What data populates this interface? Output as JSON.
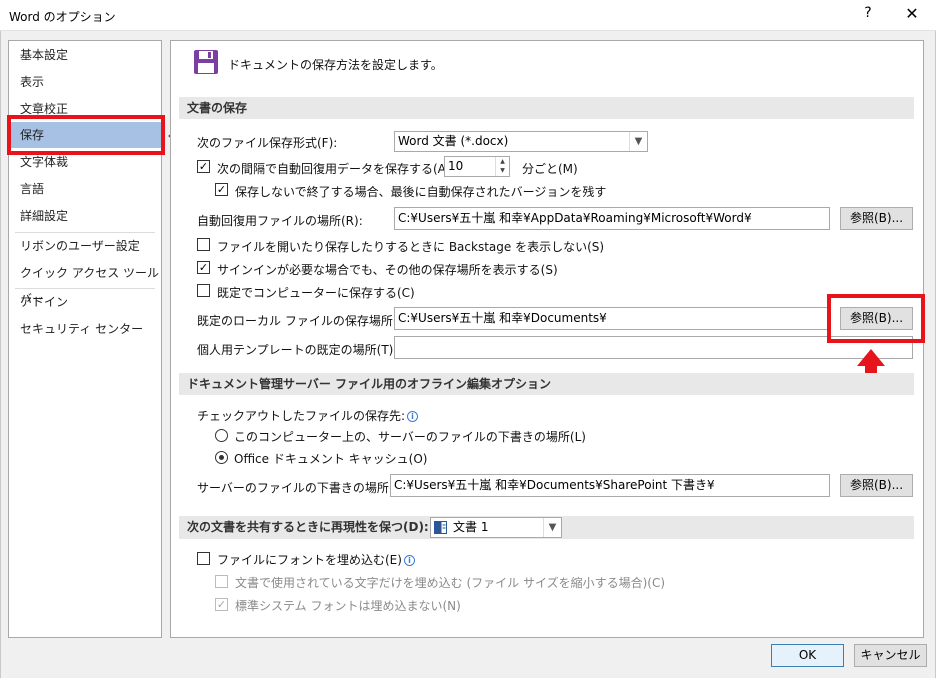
{
  "window": {
    "title": "Word のオプション",
    "help": "?",
    "close": "✕"
  },
  "sidebar": {
    "items": [
      {
        "label": "基本設定"
      },
      {
        "label": "表示"
      },
      {
        "label": "文章校正"
      },
      {
        "label": "保存"
      },
      {
        "label": "文字体裁"
      },
      {
        "label": "言語"
      },
      {
        "label": "詳細設定"
      },
      {
        "label": "リボンのユーザー設定"
      },
      {
        "label": "クイック アクセス ツール バー"
      },
      {
        "label": "アドイン"
      },
      {
        "label": "セキュリティ センター"
      }
    ]
  },
  "header": {
    "description": "ドキュメントの保存方法を設定します。",
    "icon": "floppy-disk-icon"
  },
  "doc_save": {
    "section_title": "文書の保存",
    "format_label": "次のファイル保存形式(F):",
    "format_value": "Word 文書 (*.docx)",
    "autorecover_label": "次の間隔で自動回復用データを保存する(A):",
    "autorecover_checked": "✓",
    "autorecover_minutes": "10",
    "autorecover_unit": "分ごと(M)",
    "keep_last_label": "保存しないで終了する場合、最後に自動保存されたバージョンを残す",
    "keep_last_checked": "✓",
    "autorecover_location_label": "自動回復用ファイルの場所(R):",
    "autorecover_location_value": "C:¥Users¥五十嵐 和幸¥AppData¥Roaming¥Microsoft¥Word¥",
    "browse_label": "参照(B)...",
    "backstage_label": "ファイルを開いたり保存したりするときに Backstage を表示しない(S)",
    "signin_label": "サインインが必要な場合でも、その他の保存場所を表示する(S)",
    "signin_checked": "✓",
    "save_to_computer_label": "既定でコンピューターに保存する(C)",
    "local_location_label": "既定のローカル ファイルの保存場所(I):",
    "local_location_value": "C:¥Users¥五十嵐 和幸¥Documents¥",
    "template_location_label": "個人用テンプレートの既定の場所(T):",
    "template_location_value": ""
  },
  "offline": {
    "section_title": "ドキュメント管理サーバー ファイル用のオフライン編集オプション",
    "checkout_label": "チェックアウトしたファイルの保存先:",
    "info_icon": "i",
    "radio_server_label": "このコンピューター上の、サーバーのファイルの下書きの場所(L)",
    "radio_cache_label": "Office ドキュメント キャッシュ(O)",
    "drafts_label": "サーバーのファイルの下書きの場所(V):",
    "drafts_value": "C:¥Users¥五十嵐 和幸¥Documents¥SharePoint 下書き¥"
  },
  "fidelity": {
    "section_title": "次の文書を共有するときに再現性を保つ(D):",
    "document_value": "文書 1",
    "embed_fonts_label": "ファイルにフォントを埋め込む(E)",
    "embed_used_label": "文書で使用されている文字だけを埋め込む (ファイル サイズを縮小する場合)(C)",
    "no_system_fonts_label": "標準システム フォントは埋め込まない(N)",
    "no_system_fonts_checked": "✓"
  },
  "footer": {
    "ok": "OK",
    "cancel": "キャンセル"
  },
  "colors": {
    "selected": "#a6c1e4",
    "highlight": "#e8141b"
  }
}
